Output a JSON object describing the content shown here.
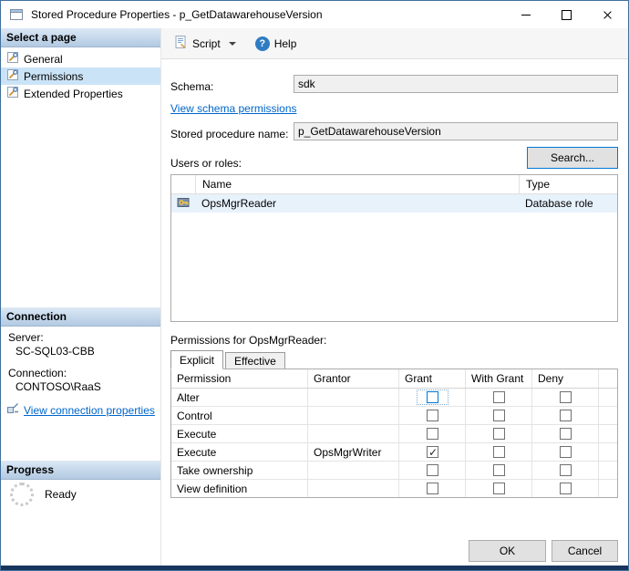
{
  "window": {
    "title": "Stored Procedure Properties - p_GetDatawarehouseVersion"
  },
  "colors": {
    "accent": "#0078d7",
    "link": "#0066cc",
    "sidebar_selection": "#cbe3f7",
    "row_highlight": "#e7f2fb",
    "window_bottom_border": "#17365d"
  },
  "icons": {
    "help_glyph": "?"
  },
  "sidebar": {
    "select_page_header": "Select a page",
    "pages": [
      {
        "label": "General",
        "selected": false
      },
      {
        "label": "Permissions",
        "selected": true
      },
      {
        "label": "Extended Properties",
        "selected": false
      }
    ],
    "connection_header": "Connection",
    "server_label": "Server:",
    "server_value": "SC-SQL03-CBB",
    "connection_label": "Connection:",
    "connection_value": "CONTOSO\\RaaS",
    "view_connection_link": "View connection properties",
    "progress_header": "Progress",
    "progress_status": "Ready"
  },
  "toolbar": {
    "script_label": "Script",
    "help_label": "Help"
  },
  "form": {
    "schema_label": "Schema:",
    "schema_value": "sdk",
    "view_schema_link": "View schema permissions",
    "proc_name_label": "Stored procedure name:",
    "proc_name_value": "p_GetDatawarehouseVersion",
    "users_roles_label": "Users or roles:",
    "search_button": "Search...",
    "users_table": {
      "columns": [
        "Name",
        "Type"
      ],
      "rows": [
        {
          "name": "OpsMgrReader",
          "type": "Database role"
        }
      ]
    },
    "permissions_label": "Permissions for OpsMgrReader:",
    "tabs": [
      {
        "label": "Explicit",
        "selected": true
      },
      {
        "label": "Effective",
        "selected": false
      }
    ],
    "permissions_table": {
      "columns": [
        "Permission",
        "Grantor",
        "Grant",
        "With Grant",
        "Deny"
      ],
      "rows": [
        {
          "permission": "Alter",
          "grantor": "",
          "grant": false,
          "with_grant": false,
          "deny": false,
          "focused": true
        },
        {
          "permission": "Control",
          "grantor": "",
          "grant": false,
          "with_grant": false,
          "deny": false
        },
        {
          "permission": "Execute",
          "grantor": "",
          "grant": false,
          "with_grant": false,
          "deny": false
        },
        {
          "permission": "Execute",
          "grantor": "OpsMgrWriter",
          "grant": true,
          "with_grant": false,
          "deny": false
        },
        {
          "permission": "Take ownership",
          "grantor": "",
          "grant": false,
          "with_grant": false,
          "deny": false
        },
        {
          "permission": "View definition",
          "grantor": "",
          "grant": false,
          "with_grant": false,
          "deny": false
        }
      ]
    }
  },
  "footer": {
    "ok_label": "OK",
    "cancel_label": "Cancel"
  }
}
